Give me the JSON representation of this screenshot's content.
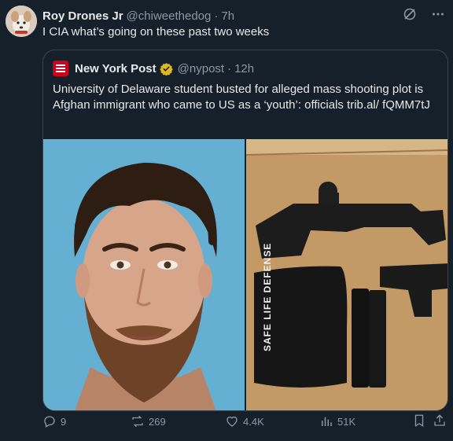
{
  "tweet": {
    "author_name": "Roy Drones Jr",
    "author_handle": "@chiweethedog",
    "time": "7h",
    "text": "I CIA what’s going on these past two weeks"
  },
  "quote": {
    "author_name": "New York Post",
    "author_handle": "@nypost",
    "time": "12h",
    "text": "University of Delaware student busted for alleged mass shooting plot is Afghan immigrant who came to US as a ‘youth’: officials trib.al/ fQMM7tJ",
    "media_label": "SAFE LIFE DEFENSE"
  },
  "actions": {
    "replies": "9",
    "reposts": "269",
    "likes": "4.4K",
    "views": "51K"
  },
  "colors": {
    "background": "#15202b",
    "text": "#e7e9ea",
    "muted": "#8b98a5",
    "border": "#38444d",
    "verified_gold": "#e2b719",
    "nypost_red": "#d0021b"
  },
  "icons": [
    "grok-icon",
    "more-icon",
    "verified-badge-icon",
    "reply-icon",
    "repost-icon",
    "like-icon",
    "views-icon",
    "bookmark-icon",
    "share-icon"
  ]
}
